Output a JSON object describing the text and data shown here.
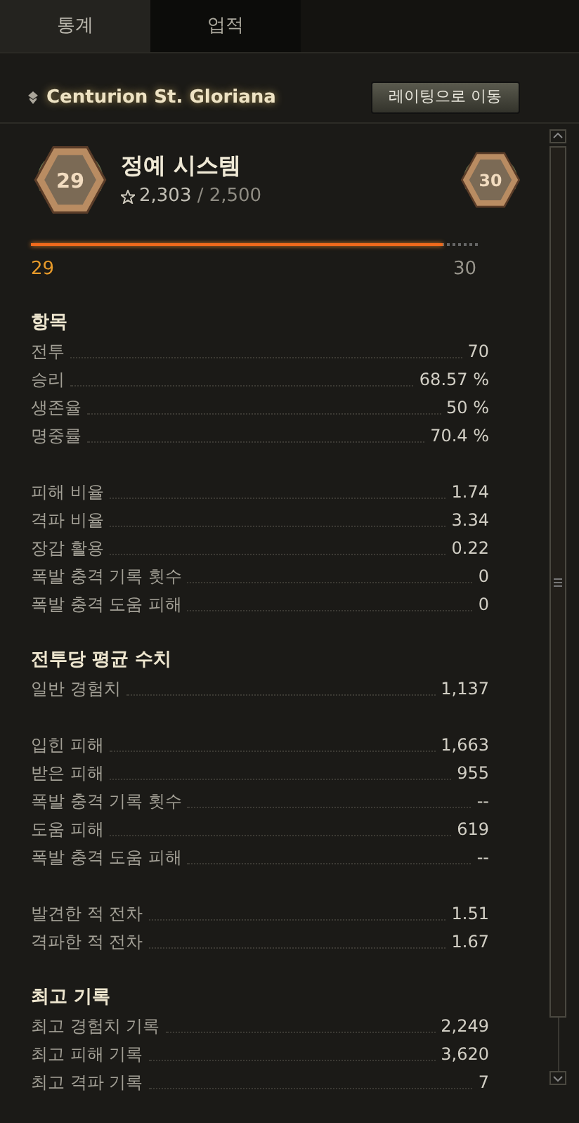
{
  "tabs": [
    {
      "label": "통계",
      "selected": true
    },
    {
      "label": "업적",
      "selected": false
    }
  ],
  "vehicle": {
    "name": "Centurion St. Gloriana",
    "button": "레이팅으로 이동"
  },
  "elite": {
    "title": "정예 시스템",
    "points": "2,303",
    "total": " / 2,500",
    "current_badge": "29",
    "next_badge": "30",
    "level": 0.92,
    "current_label": "29",
    "next_label": "30"
  },
  "sections": [
    {
      "title": "항목",
      "groups": [
        [
          {
            "label": "전투",
            "value": "70"
          },
          {
            "label": "승리",
            "value": "68.57 %"
          },
          {
            "label": "생존율",
            "value": "50 %"
          },
          {
            "label": "명중률",
            "value": "70.4 %"
          }
        ],
        [
          {
            "label": "피해 비율",
            "value": "1.74"
          },
          {
            "label": "격파 비율",
            "value": "3.34"
          },
          {
            "label": "장갑 활용",
            "value": "0.22"
          },
          {
            "label": "폭발 충격 기록 횟수",
            "value": "0"
          },
          {
            "label": "폭발 충격 도움 피해",
            "value": "0"
          }
        ]
      ]
    },
    {
      "title": "전투당 평균 수치",
      "groups": [
        [
          {
            "label": "일반 경험치",
            "value": "1,137"
          }
        ],
        [
          {
            "label": "입힌 피해",
            "value": "1,663"
          },
          {
            "label": "받은 피해",
            "value": "955"
          },
          {
            "label": "폭발 충격 기록 횟수",
            "value": "--"
          },
          {
            "label": "도움 피해",
            "value": "619"
          },
          {
            "label": "폭발 충격 도움 피해",
            "value": "--"
          }
        ],
        [
          {
            "label": "발견한 적 전차",
            "value": "1.51"
          },
          {
            "label": "격파한 적 전차",
            "value": "1.67"
          }
        ]
      ]
    },
    {
      "title": "최고 기록",
      "groups": [
        [
          {
            "label": "최고 경험치 기록",
            "value": "2,249"
          },
          {
            "label": "최고 피해 기록",
            "value": "3,620"
          },
          {
            "label": "최고 격파 기록",
            "value": "7"
          }
        ]
      ]
    }
  ]
}
